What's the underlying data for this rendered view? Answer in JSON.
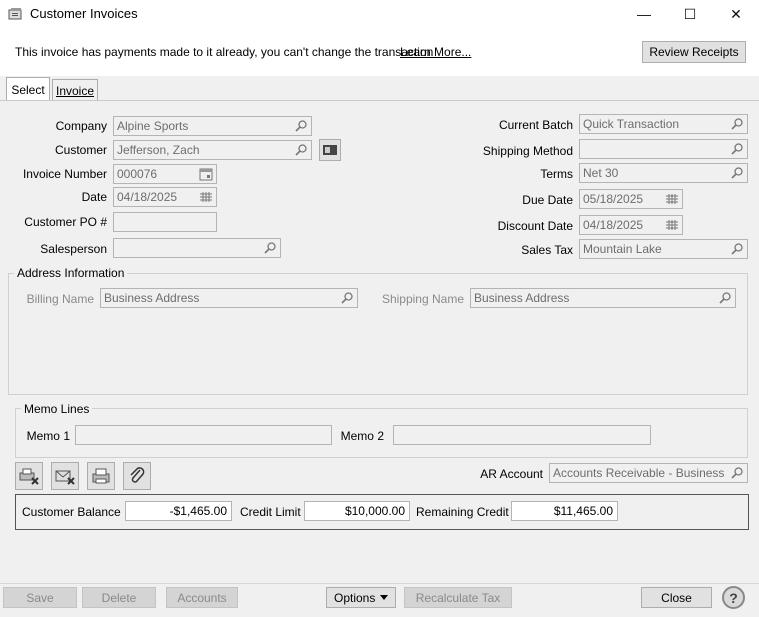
{
  "window": {
    "title": "Customer Invoices",
    "minimize": "—",
    "maximize": "☐",
    "close": "✕"
  },
  "notice": {
    "text": "This invoice has payments made to it already, you can't change the transaction",
    "learn_more": "Learn More...",
    "review_receipts": "Review Receipts"
  },
  "tabs": [
    {
      "label": "Select"
    },
    {
      "label": "Invoice"
    }
  ],
  "form": {
    "company": {
      "label": "Company",
      "value": "Alpine Sports"
    },
    "customer": {
      "label": "Customer",
      "value": "Jefferson, Zach"
    },
    "invoice_number": {
      "label": "Invoice Number",
      "value": "000076"
    },
    "date": {
      "label": "Date",
      "value": "04/18/2025"
    },
    "customer_po": {
      "label": "Customer PO #",
      "value": ""
    },
    "salesperson": {
      "label": "Salesperson",
      "value": ""
    },
    "current_batch": {
      "label": "Current Batch",
      "value": "Quick Transaction"
    },
    "shipping_method": {
      "label": "Shipping Method",
      "value": ""
    },
    "terms": {
      "label": "Terms",
      "value": "Net 30"
    },
    "due_date": {
      "label": "Due Date",
      "value": "05/18/2025"
    },
    "discount_date": {
      "label": "Discount Date",
      "value": "04/18/2025"
    },
    "sales_tax": {
      "label": "Sales Tax",
      "value": "Mountain Lake"
    }
  },
  "address": {
    "title": "Address Information",
    "billing_label": "Billing Name",
    "billing_value": "Business Address",
    "shipping_label": "Shipping Name",
    "shipping_value": "Business Address"
  },
  "memo": {
    "title": "Memo Lines",
    "memo1_label": "Memo 1",
    "memo1_value": "",
    "memo2_label": "Memo 2",
    "memo2_value": ""
  },
  "ar_account": {
    "label": "AR Account",
    "value": "Accounts Receivable - Business"
  },
  "balance": {
    "customer_balance_label": "Customer Balance",
    "customer_balance": "-$1,465.00",
    "credit_limit_label": "Credit Limit",
    "credit_limit": "$10,000.00",
    "remaining_credit_label": "Remaining Credit",
    "remaining_credit": "$11,465.00"
  },
  "bottom": {
    "save": "Save",
    "delete": "Delete",
    "accounts": "Accounts",
    "options": "Options",
    "recalculate_tax": "Recalculate Tax",
    "close": "Close",
    "help": "?"
  }
}
